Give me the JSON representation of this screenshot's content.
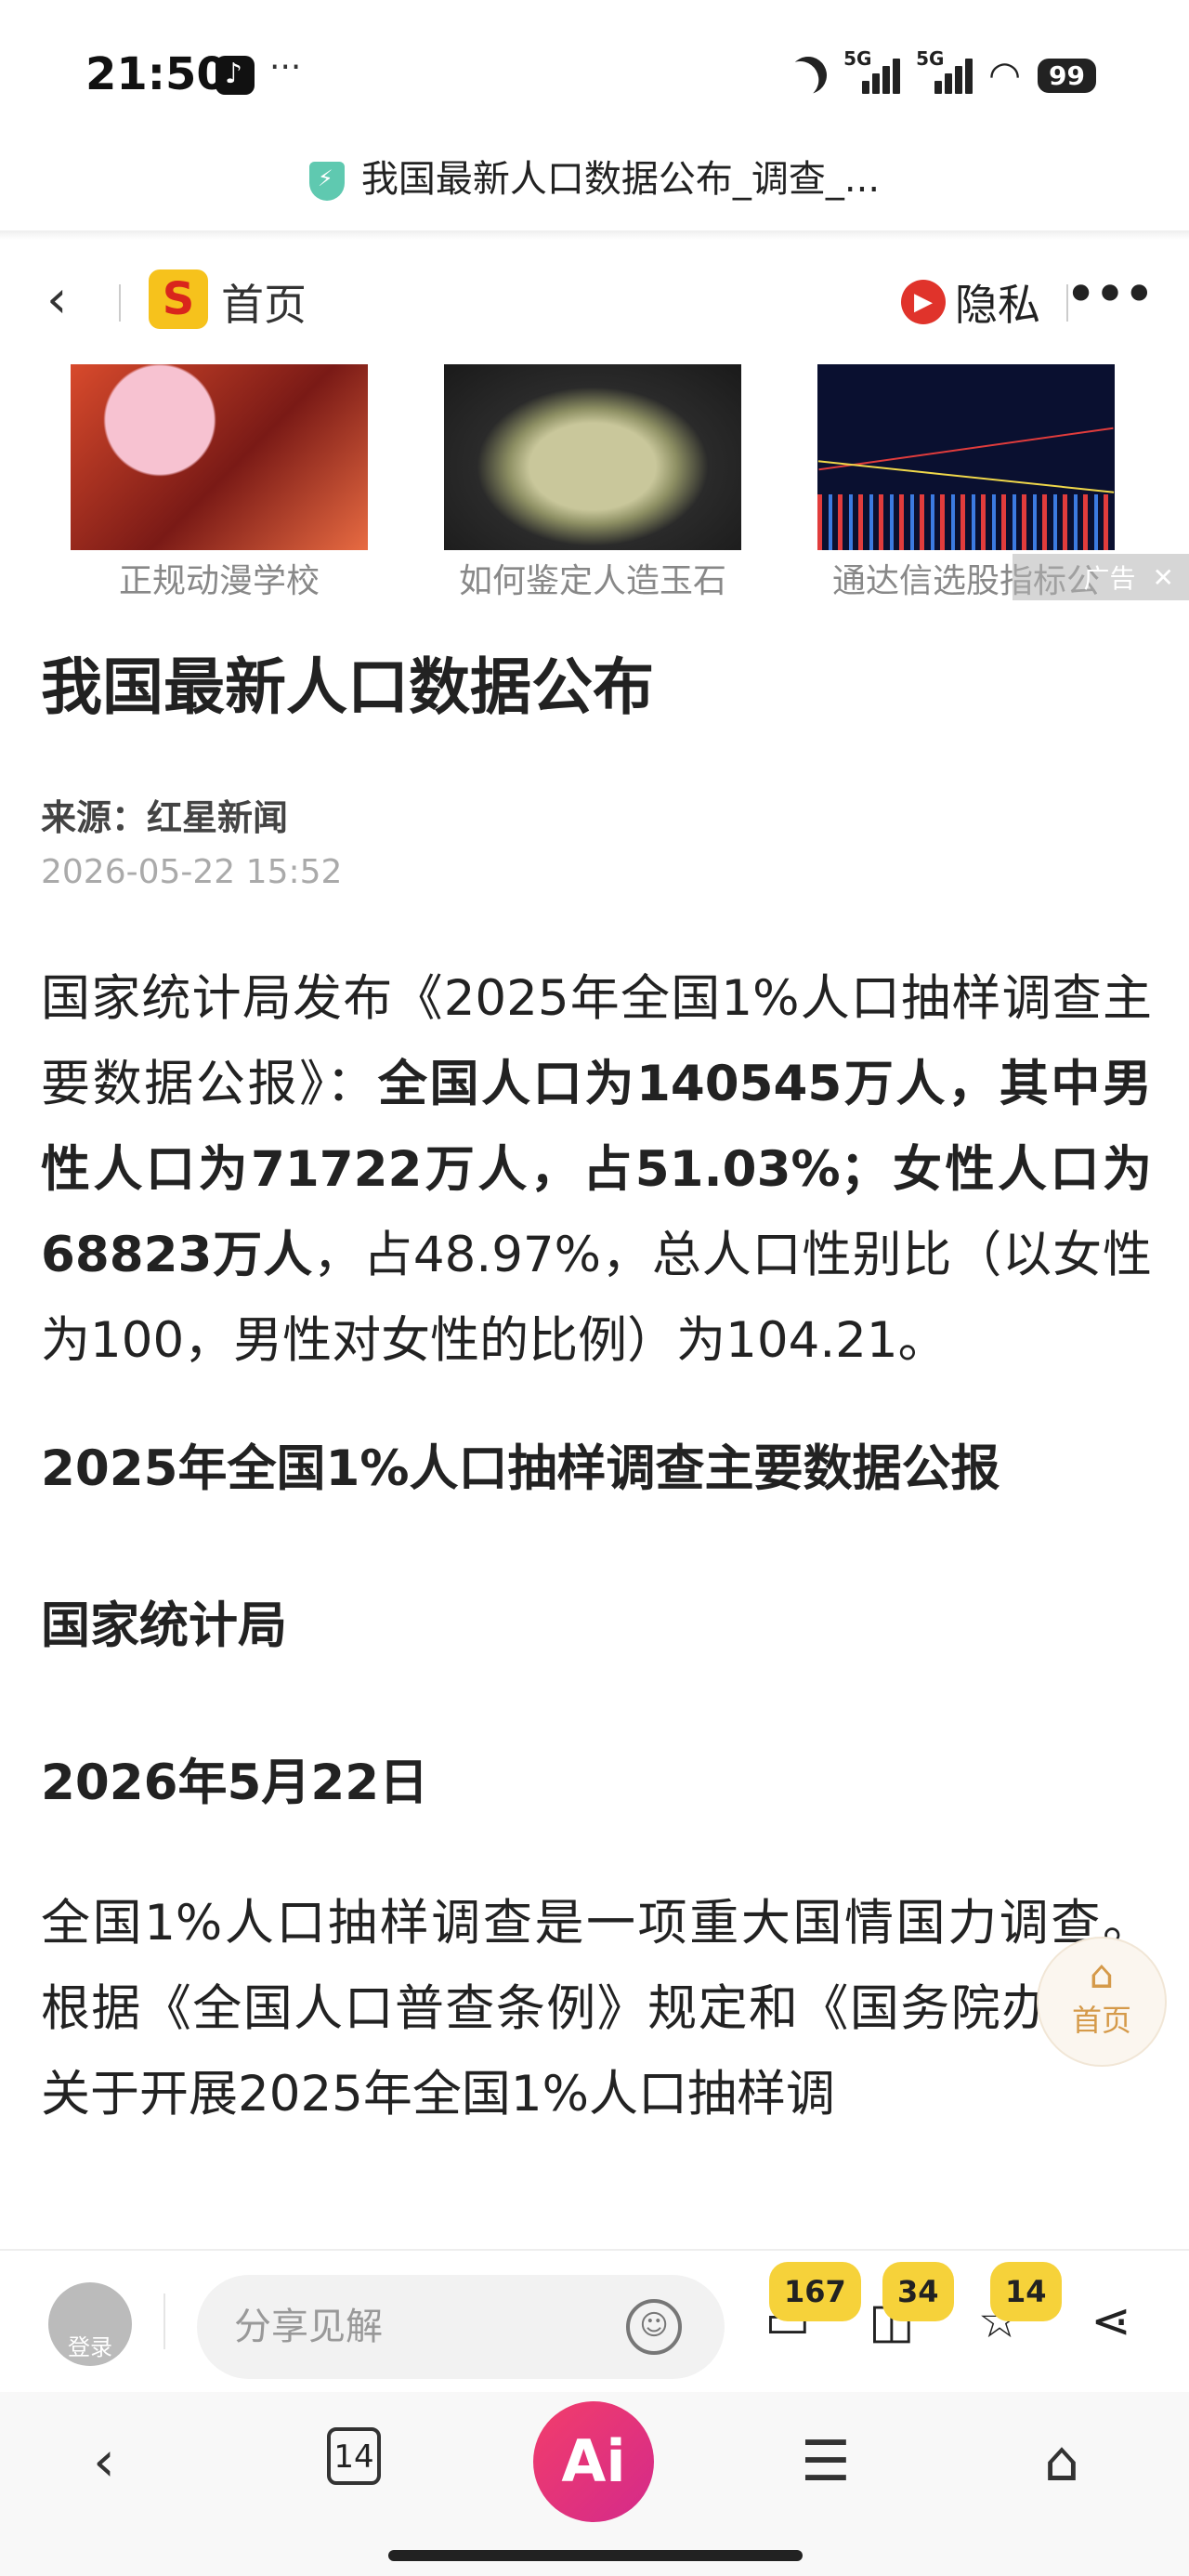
{
  "status_bar": {
    "time": "21:50",
    "more": "···",
    "signal_label_1": "5G",
    "signal_label_2": "5G",
    "battery": "99"
  },
  "tab": {
    "title": "我国最新人口数据公布_调查_..."
  },
  "nav": {
    "home_label": "首页",
    "privacy_label": "隐私",
    "logo_letter": "S"
  },
  "ads": {
    "items": [
      {
        "caption": "正规动漫学校"
      },
      {
        "caption": "如何鉴定人造玉石"
      },
      {
        "caption": "通达信选股指标公"
      }
    ],
    "ad_tag": "广告",
    "close_glyph": "✕"
  },
  "article": {
    "headline": "我国最新人口数据公布",
    "source": "来源：红星新闻",
    "date": "2026-05-22 15:52",
    "para1_intro": "国家统计局发布《2025年全国1%人口抽样调查主要数据公报》：",
    "para1_bold": "全国人口为140545万人，其中男性人口为71722万人，占51.03%；女性人口为68823万人",
    "para1_rest": "，占48.97%，总人口性别比（以女性为100，男性对女性的比例）为104.21。",
    "section1": "2025年全国1%人口抽样调查主要数据公报",
    "section2": "国家统计局",
    "section3": "2026年5月22日",
    "para2": "全国1%人口抽样调查是一项重大国情国力调查。根据《全国人口普查条例》规定和《国务院办公厅关于开展2025年全国1%人口抽样调"
  },
  "float_home": {
    "label": "首页"
  },
  "comment_bar": {
    "avatar_label": "登录",
    "input_placeholder": "分享见解",
    "comments_count": "167",
    "shares_count": "34",
    "favorites_count": "14"
  },
  "bottom_nav": {
    "tabs_count": "14",
    "ai_label": "Ai"
  }
}
